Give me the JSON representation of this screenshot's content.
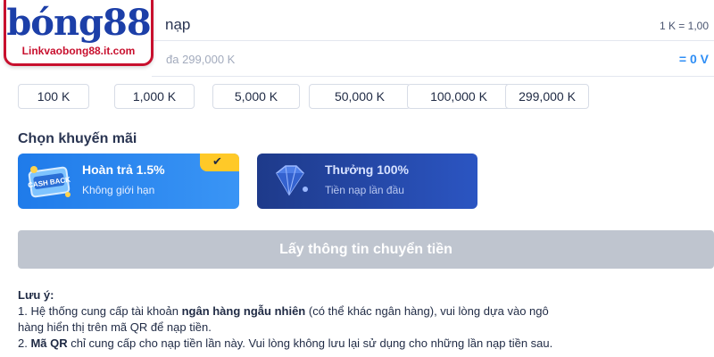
{
  "logo": {
    "brand": "bóng88",
    "site": "Linkvaobong88.it.com"
  },
  "deposit": {
    "label": "nạp",
    "rate": "1 K = 1,00",
    "placeholder": "đa 299,000 K",
    "converted": "= 0 V"
  },
  "quick_amounts": [
    "100 K",
    "1,000 K",
    "5,000 K",
    "50,000 K",
    "100,000 K",
    "299,000 K"
  ],
  "promotions": {
    "title": "Chọn khuyến mãi",
    "items": [
      {
        "title": "Hoàn trả 1.5%",
        "subtitle": "Không giới hạn",
        "selected": true,
        "badge_text": "CASH BACK",
        "icon": "check-icon"
      },
      {
        "title": "Thưởng 100%",
        "subtitle": "Tiền nạp lần đầu",
        "selected": false,
        "icon": "diamond-icon"
      }
    ]
  },
  "action_button": "Lấy thông tin chuyển tiền",
  "notes": {
    "heading": "Lưu ý:",
    "line1_prefix": "1. Hệ thống cung cấp tài khoản ",
    "line1_bold": "ngân hàng ngẫu nhiên",
    "line1_suffix": " (có thể khác ngân hàng), vui lòng dựa vào ngô",
    "line1_cont": "hàng hiển thị trên mã QR để nạp tiền.",
    "line2_prefix": "2. ",
    "line2_bold": "Mã QR",
    "line2_suffix": " chỉ cung cấp cho nạp tiền lần này. Vui lòng không lưu lại sử dụng cho những lần nạp tiền sau."
  },
  "colors": {
    "accent": "#2f8ef5",
    "promo_selected": "#1f7bea",
    "promo_other": "#1e3a8a",
    "badge": "#ffc928",
    "disabled_button": "#bfc5cf",
    "logo_red": "#c8102e",
    "logo_blue": "#1c3fa8"
  }
}
